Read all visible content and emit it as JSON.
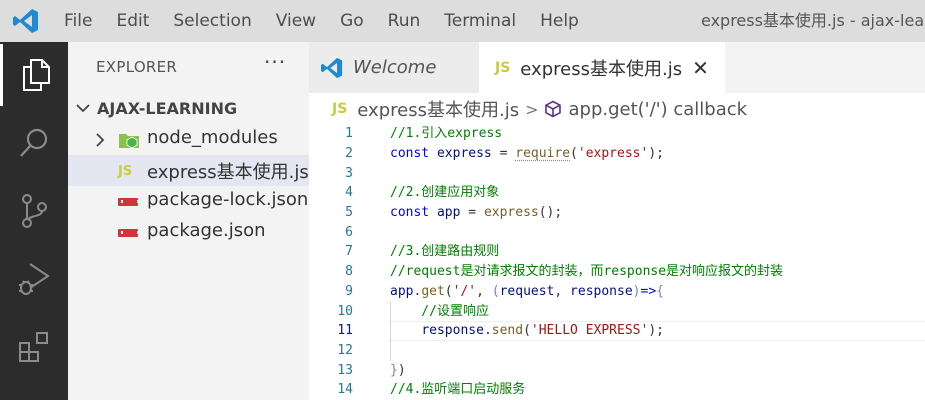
{
  "menubar": {
    "items": [
      "File",
      "Edit",
      "Selection",
      "View",
      "Go",
      "Run",
      "Terminal",
      "Help"
    ],
    "window_title": "express基本使用.js - ajax-learning"
  },
  "activitybar": {
    "icons": [
      "explorer-icon",
      "search-icon",
      "source-control-icon",
      "run-debug-icon",
      "extensions-icon"
    ]
  },
  "sidebar": {
    "title": "EXPLORER",
    "more": "···",
    "folder": "AJAX-LEARNING",
    "files": [
      {
        "name": "node_modules",
        "type": "folder"
      },
      {
        "name": "express基本使用.js",
        "type": "js",
        "badge": "JS"
      },
      {
        "name": "package-lock.json",
        "type": "npm"
      },
      {
        "name": "package.json",
        "type": "npm"
      }
    ]
  },
  "tabs": [
    {
      "label": "Welcome"
    },
    {
      "label": "express基本使用.js",
      "badge": "JS",
      "close": "✕"
    }
  ],
  "breadcrumb": {
    "badge": "JS",
    "file": "express基本使用.js",
    "separator": ">",
    "symbol": "app.get('/') callback"
  },
  "code": {
    "line_numbers": [
      "1",
      "2",
      "3",
      "4",
      "5",
      "6",
      "7",
      "8",
      "9",
      "10",
      "11",
      "12",
      "13",
      "14"
    ],
    "lines": [
      "//1.引入express",
      "const express = require('express');",
      "",
      "//2.创建应用对象",
      "const app = express();",
      "",
      "//3.创建路由规则",
      "//request是对请求报文的封装，而response是对响应报文的封装",
      "app.get('/', (request, response)=>{",
      "    //设置响应",
      "    response.send('HELLO EXPRESS');",
      "",
      "})",
      "//4.监听端口启动服务"
    ],
    "current_line": 11
  },
  "colors": {
    "activitybar": "#2c2c2c",
    "menubar": "#dddddd",
    "accent": "#0066b8",
    "annotation_arrow": "#e02020"
  }
}
